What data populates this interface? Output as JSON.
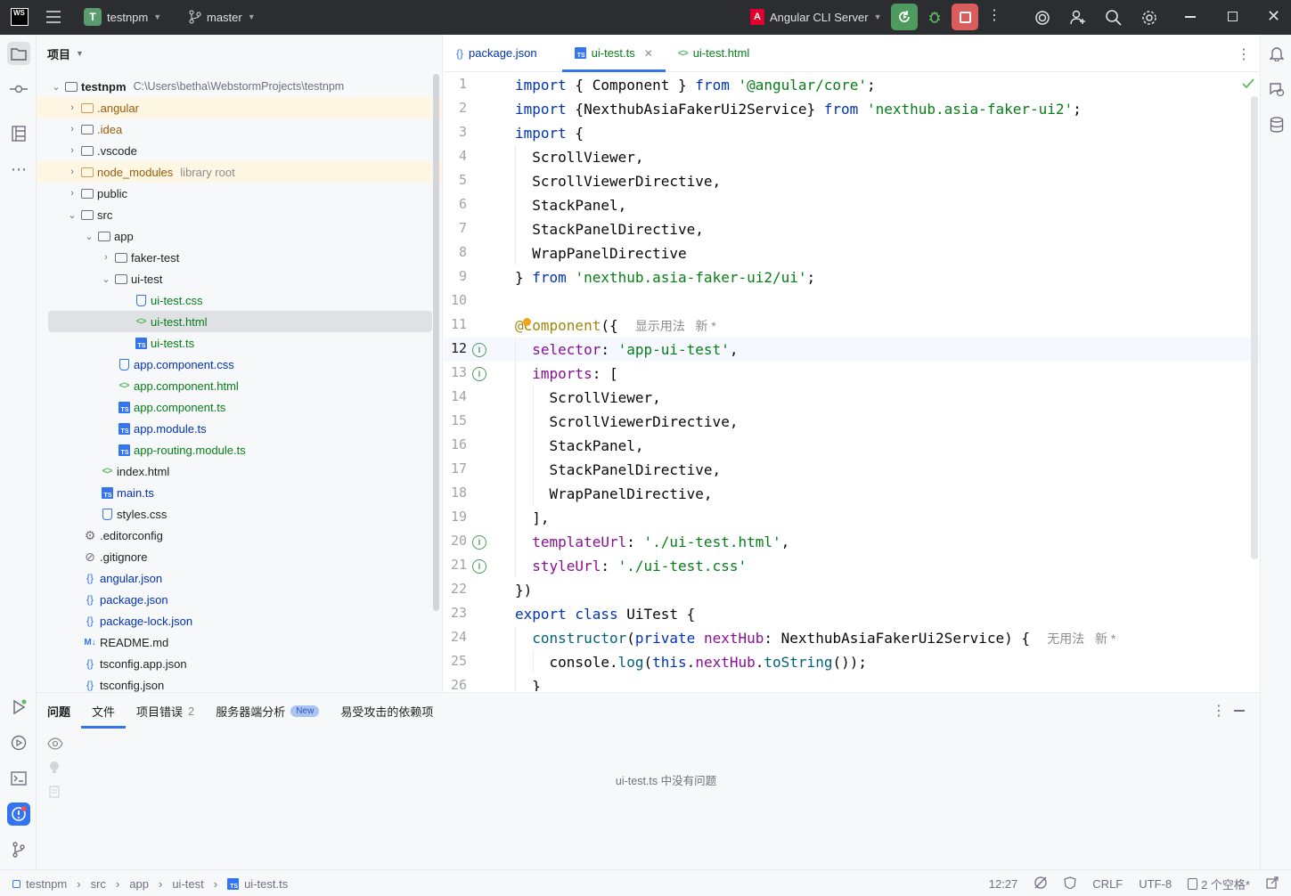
{
  "titlebar": {
    "app_logo": "WS",
    "project_badge": "T",
    "project_name": "testnpm",
    "branch": "master",
    "run_config": "Angular CLI Server"
  },
  "project_panel": {
    "title": "项目",
    "root_name": "testnpm",
    "root_path": "C:\\Users\\betha\\WebstormProjects\\testnpm",
    "items": [
      {
        "label": ".angular",
        "suffix": ""
      },
      {
        "label": ".idea",
        "suffix": ""
      },
      {
        "label": ".vscode",
        "suffix": ""
      },
      {
        "label": "node_modules",
        "suffix": "library root"
      },
      {
        "label": "public",
        "suffix": ""
      },
      {
        "label": "src",
        "suffix": ""
      },
      {
        "label": "app",
        "suffix": ""
      },
      {
        "label": "faker-test",
        "suffix": ""
      },
      {
        "label": "ui-test",
        "suffix": ""
      },
      {
        "label": "ui-test.css",
        "suffix": ""
      },
      {
        "label": "ui-test.html",
        "suffix": ""
      },
      {
        "label": "ui-test.ts",
        "suffix": ""
      },
      {
        "label": "app.component.css",
        "suffix": ""
      },
      {
        "label": "app.component.html",
        "suffix": ""
      },
      {
        "label": "app.component.ts",
        "suffix": ""
      },
      {
        "label": "app.module.ts",
        "suffix": ""
      },
      {
        "label": "app-routing.module.ts",
        "suffix": ""
      },
      {
        "label": "index.html",
        "suffix": ""
      },
      {
        "label": "main.ts",
        "suffix": ""
      },
      {
        "label": "styles.css",
        "suffix": ""
      },
      {
        "label": ".editorconfig",
        "suffix": ""
      },
      {
        "label": ".gitignore",
        "suffix": ""
      },
      {
        "label": "angular.json",
        "suffix": ""
      },
      {
        "label": "package.json",
        "suffix": ""
      },
      {
        "label": "package-lock.json",
        "suffix": ""
      },
      {
        "label": "README.md",
        "suffix": ""
      },
      {
        "label": "tsconfig.app.json",
        "suffix": ""
      },
      {
        "label": "tsconfig.json",
        "suffix": ""
      }
    ]
  },
  "tabs": [
    {
      "label": "package.json"
    },
    {
      "label": "ui-test.ts"
    },
    {
      "label": "ui-test.html"
    }
  ],
  "editor": {
    "line_numbers": [
      "1",
      "2",
      "3",
      "4",
      "5",
      "6",
      "7",
      "8",
      "9",
      "10",
      "11",
      "12",
      "13",
      "14",
      "15",
      "16",
      "17",
      "18",
      "19",
      "20",
      "21",
      "22",
      "23",
      "24",
      "25",
      "26"
    ],
    "lines": [
      [
        [
          "kw",
          "import"
        ],
        [
          "t",
          " { Component } "
        ],
        [
          "kw",
          "from"
        ],
        [
          "t",
          " "
        ],
        [
          "str",
          "'@angular/core'"
        ],
        [
          "t",
          ";"
        ]
      ],
      [
        [
          "kw",
          "import"
        ],
        [
          "t",
          " {NexthubAsiaFakerUi2Service} "
        ],
        [
          "kw",
          "from"
        ],
        [
          "t",
          " "
        ],
        [
          "str",
          "'nexthub.asia-faker-ui2'"
        ],
        [
          "t",
          ";"
        ]
      ],
      [
        [
          "kw",
          "import"
        ],
        [
          "t",
          " {"
        ]
      ],
      [
        [
          "t",
          "  ScrollViewer,"
        ]
      ],
      [
        [
          "t",
          "  ScrollViewerDirective,"
        ]
      ],
      [
        [
          "t",
          "  StackPanel,"
        ]
      ],
      [
        [
          "t",
          "  StackPanelDirective,"
        ]
      ],
      [
        [
          "t",
          "  WrapPanelDirective"
        ]
      ],
      [
        [
          "t",
          "} "
        ],
        [
          "kw",
          "from"
        ],
        [
          "t",
          " "
        ],
        [
          "str",
          "'nexthub.asia-faker-ui2/ui'"
        ],
        [
          "t",
          ";"
        ]
      ],
      [
        [
          "t",
          ""
        ]
      ],
      [
        [
          "ann",
          "@Component"
        ],
        [
          "t",
          "({  "
        ],
        [
          "hint",
          "显示用法   新 *"
        ]
      ],
      [
        [
          "t",
          "  "
        ],
        [
          "fld",
          "selector"
        ],
        [
          "t",
          ": "
        ],
        [
          "str",
          "'app-ui-test'"
        ],
        [
          "t",
          ","
        ]
      ],
      [
        [
          "t",
          "  "
        ],
        [
          "fld",
          "imports"
        ],
        [
          "t",
          ": ["
        ]
      ],
      [
        [
          "t",
          "    ScrollViewer,"
        ]
      ],
      [
        [
          "t",
          "    ScrollViewerDirective,"
        ]
      ],
      [
        [
          "t",
          "    StackPanel,"
        ]
      ],
      [
        [
          "t",
          "    StackPanelDirective,"
        ]
      ],
      [
        [
          "t",
          "    WrapPanelDirective,"
        ]
      ],
      [
        [
          "t",
          "  ],"
        ]
      ],
      [
        [
          "t",
          "  "
        ],
        [
          "fld",
          "templateUrl"
        ],
        [
          "t",
          ": "
        ],
        [
          "str",
          "'./ui-test.html'"
        ],
        [
          "t",
          ","
        ]
      ],
      [
        [
          "t",
          "  "
        ],
        [
          "fld",
          "styleUrl"
        ],
        [
          "t",
          ": "
        ],
        [
          "str",
          "'./ui-test.css'"
        ]
      ],
      [
        [
          "t",
          "})"
        ]
      ],
      [
        [
          "kw",
          "export class"
        ],
        [
          "t",
          " UiTest {"
        ]
      ],
      [
        [
          "t",
          "  "
        ],
        [
          "fn",
          "constructor"
        ],
        [
          "t",
          "("
        ],
        [
          "kw",
          "private"
        ],
        [
          "t",
          " "
        ],
        [
          "fld",
          "nextHub"
        ],
        [
          "t",
          ": NexthubAsiaFakerUi2Service) {  "
        ],
        [
          "hint",
          "无用法   新 *"
        ]
      ],
      [
        [
          "t",
          "    console."
        ],
        [
          "fn",
          "log"
        ],
        [
          "t",
          "("
        ],
        [
          "kw",
          "this"
        ],
        [
          "t",
          "."
        ],
        [
          "fld",
          "nextHub"
        ],
        [
          "t",
          "."
        ],
        [
          "fn",
          "toString"
        ],
        [
          "t",
          "());"
        ]
      ],
      [
        [
          "t",
          "  }"
        ]
      ]
    ]
  },
  "bottom_panel": {
    "tabs": [
      {
        "label": "问题"
      },
      {
        "label": "文件"
      },
      {
        "label": "项目错误",
        "count": "2"
      },
      {
        "label": "服务器端分析",
        "badge": "New"
      },
      {
        "label": "易受攻击的依赖项"
      }
    ],
    "empty_message": "ui-test.ts 中没有问题"
  },
  "statusbar": {
    "breadcrumbs": [
      "testnpm",
      "src",
      "app",
      "ui-test",
      "ui-test.ts"
    ],
    "position": "12:27",
    "line_ending": "CRLF",
    "encoding": "UTF-8",
    "indent": "2 个空格*"
  }
}
